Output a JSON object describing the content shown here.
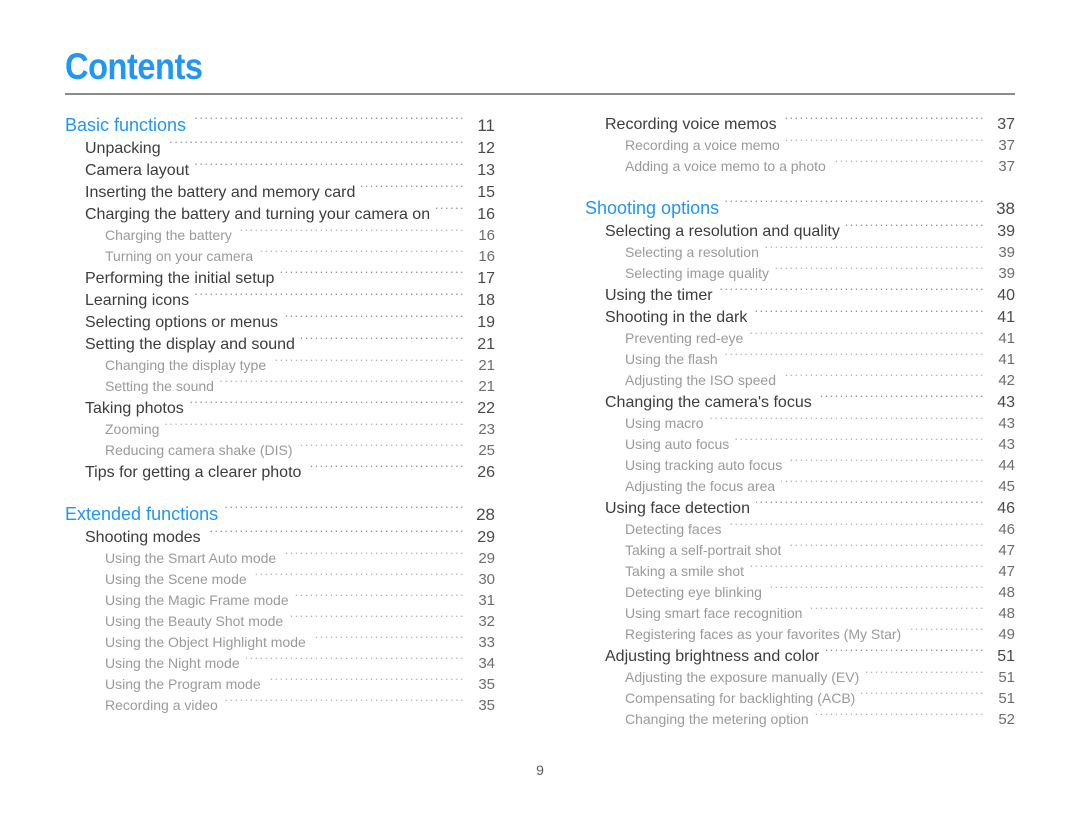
{
  "document": {
    "title": "Contents",
    "folio": "9",
    "accent_color": "#2196f3",
    "rule_color": "#8c8c8c"
  },
  "columns": [
    {
      "name": "left-column",
      "entries": [
        {
          "level": 0,
          "label": "Basic functions",
          "page": "11"
        },
        {
          "level": 1,
          "label": "Unpacking",
          "page": "12"
        },
        {
          "level": 1,
          "label": "Camera layout",
          "page": "13"
        },
        {
          "level": 1,
          "label": "Inserting the battery and memory card",
          "page": "15"
        },
        {
          "level": 1,
          "label": "Charging the battery and turning your camera on",
          "page": "16"
        },
        {
          "level": 2,
          "label": "Charging the battery",
          "page": "16"
        },
        {
          "level": 2,
          "label": "Turning on your camera",
          "page": "16"
        },
        {
          "level": 1,
          "label": "Performing the initial setup",
          "page": "17"
        },
        {
          "level": 1,
          "label": "Learning icons",
          "page": "18"
        },
        {
          "level": 1,
          "label": "Selecting options or menus",
          "page": "19"
        },
        {
          "level": 1,
          "label": "Setting the display and sound",
          "page": "21"
        },
        {
          "level": 2,
          "label": "Changing the display type",
          "page": "21"
        },
        {
          "level": 2,
          "label": "Setting the sound",
          "page": "21"
        },
        {
          "level": 1,
          "label": "Taking photos",
          "page": "22"
        },
        {
          "level": 2,
          "label": "Zooming",
          "page": "23"
        },
        {
          "level": 2,
          "label": "Reducing camera shake (DIS)",
          "page": "25"
        },
        {
          "level": 1,
          "label": "Tips for getting a clearer photo",
          "page": "26"
        },
        {
          "level": "gap"
        },
        {
          "level": 0,
          "label": "Extended functions",
          "page": "28"
        },
        {
          "level": 1,
          "label": "Shooting modes",
          "page": "29"
        },
        {
          "level": 2,
          "label": "Using the Smart Auto mode",
          "page": "29"
        },
        {
          "level": 2,
          "label": "Using the Scene mode",
          "page": "30"
        },
        {
          "level": 2,
          "label": "Using the Magic Frame mode",
          "page": "31"
        },
        {
          "level": 2,
          "label": "Using the Beauty Shot mode",
          "page": "32"
        },
        {
          "level": 2,
          "label": "Using the Object Highlight mode",
          "page": "33"
        },
        {
          "level": 2,
          "label": "Using the Night mode",
          "page": "34"
        },
        {
          "level": 2,
          "label": "Using the Program mode",
          "page": "35"
        },
        {
          "level": 2,
          "label": "Recording a video",
          "page": "35"
        }
      ]
    },
    {
      "name": "right-column",
      "entries": [
        {
          "level": 1,
          "label": "Recording voice memos",
          "page": "37"
        },
        {
          "level": 2,
          "label": "Recording a voice memo",
          "page": "37"
        },
        {
          "level": 2,
          "label": "Adding a voice memo to a photo",
          "page": "37"
        },
        {
          "level": "gap"
        },
        {
          "level": 0,
          "label": "Shooting options",
          "page": "38"
        },
        {
          "level": 1,
          "label": "Selecting a resolution and quality",
          "page": "39"
        },
        {
          "level": 2,
          "label": "Selecting a resolution",
          "page": "39"
        },
        {
          "level": 2,
          "label": "Selecting image quality",
          "page": "39"
        },
        {
          "level": 1,
          "label": "Using the timer",
          "page": "40"
        },
        {
          "level": 1,
          "label": "Shooting in the dark",
          "page": "41"
        },
        {
          "level": 2,
          "label": "Preventing red-eye",
          "page": "41"
        },
        {
          "level": 2,
          "label": "Using the flash",
          "page": "41"
        },
        {
          "level": 2,
          "label": "Adjusting the ISO speed",
          "page": "42"
        },
        {
          "level": 1,
          "label": "Changing the camera's focus",
          "page": "43"
        },
        {
          "level": 2,
          "label": "Using macro",
          "page": "43"
        },
        {
          "level": 2,
          "label": "Using auto focus",
          "page": "43"
        },
        {
          "level": 2,
          "label": "Using tracking auto focus",
          "page": "44"
        },
        {
          "level": 2,
          "label": "Adjusting the focus area",
          "page": "45"
        },
        {
          "level": 1,
          "label": "Using face detection",
          "page": "46"
        },
        {
          "level": 2,
          "label": "Detecting faces",
          "page": "46"
        },
        {
          "level": 2,
          "label": "Taking a self-portrait shot",
          "page": "47"
        },
        {
          "level": 2,
          "label": "Taking a smile shot",
          "page": "47"
        },
        {
          "level": 2,
          "label": "Detecting eye blinking",
          "page": "48"
        },
        {
          "level": 2,
          "label": "Using smart face recognition",
          "page": "48"
        },
        {
          "level": 2,
          "label": "Registering faces as your favorites (My Star)",
          "page": "49"
        },
        {
          "level": 1,
          "label": "Adjusting brightness and color",
          "page": "51"
        },
        {
          "level": 2,
          "label": "Adjusting the exposure manually (EV)",
          "page": "51"
        },
        {
          "level": 2,
          "label": "Compensating for backlighting (ACB)",
          "page": "51"
        },
        {
          "level": 2,
          "label": "Changing the metering option",
          "page": "52"
        }
      ]
    }
  ]
}
